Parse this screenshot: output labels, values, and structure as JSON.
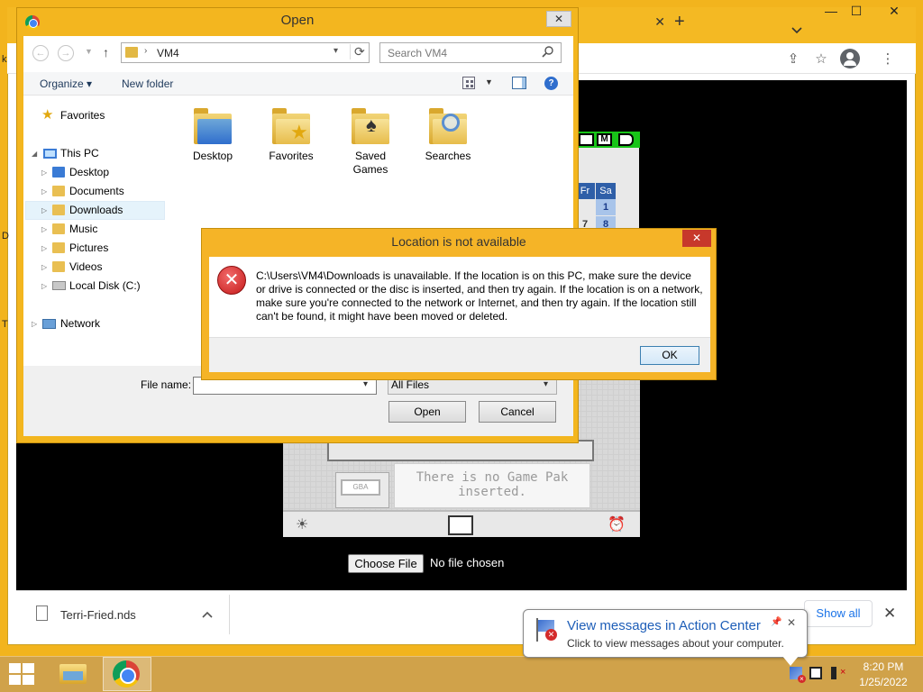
{
  "browser": {
    "tab_close": "✕",
    "new_tab": "+",
    "menu": "⋮",
    "minimize": "—",
    "maximize": "☐",
    "close": "✕",
    "share_icon": "⇪",
    "bookmark_icon": "☆"
  },
  "emulator": {
    "top_buttons": [
      "M",
      ""
    ],
    "calendar_headers": [
      "Fr",
      "Sa"
    ],
    "calendar_values": [
      "1",
      "7",
      "8"
    ],
    "card_label": "GBA",
    "no_game_message": "There is no Game Pak inserted.",
    "choose_file_label": "Choose File",
    "file_status": "No file chosen"
  },
  "download_shelf": {
    "filename": "Terri-Fried.nds",
    "show_all": "Show all",
    "close": "✕"
  },
  "open_dialog": {
    "title": "Open",
    "close": "✕",
    "address_folder": "VM4",
    "search_placeholder": "Search VM4",
    "organize": "Organize ▾",
    "new_folder": "New folder",
    "help": "?",
    "nav_items": [
      {
        "label": "Favorites"
      },
      {
        "label": "This PC"
      },
      {
        "label": "Desktop"
      },
      {
        "label": "Documents"
      },
      {
        "label": "Downloads"
      },
      {
        "label": "Music"
      },
      {
        "label": "Pictures"
      },
      {
        "label": "Videos"
      },
      {
        "label": "Local Disk (C:)"
      },
      {
        "label": "Network"
      }
    ],
    "folders": [
      {
        "label": "Desktop"
      },
      {
        "label": "Favorites"
      },
      {
        "label": "Saved\nGames"
      },
      {
        "label": "Searches"
      }
    ],
    "file_name_label": "File name:",
    "file_name_value": "",
    "file_type": "All Files",
    "open_button": "Open",
    "cancel_button": "Cancel"
  },
  "error_dialog": {
    "title": "Location is not available",
    "close": "✕",
    "message": "C:\\Users\\VM4\\Downloads is unavailable. If the location is on this PC, make sure the device or drive is connected or the disc is inserted, and then try again. If the location is on a network, make sure you're connected to the network or Internet, and then try again. If the location still can't be found, it might have been moved or deleted.",
    "ok_button": "OK"
  },
  "notification": {
    "title": "View messages in Action Center",
    "text": "Click to view messages about your computer.",
    "close": "✕"
  },
  "taskbar": {
    "time": "8:20 PM",
    "date": "1/25/2022"
  },
  "left_edge_glyphs": [
    "k",
    "D",
    "T"
  ]
}
